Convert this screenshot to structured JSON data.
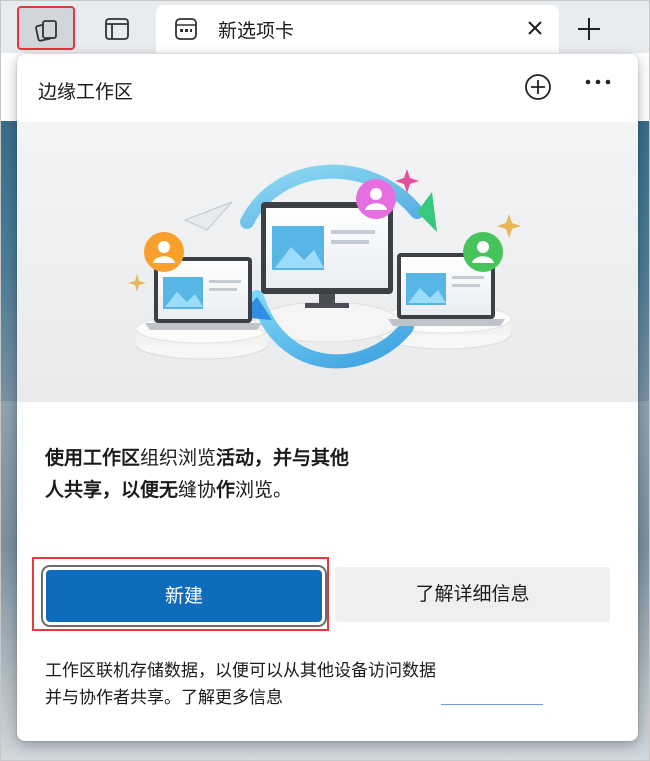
{
  "tabstrip": {
    "workspaces_icon": "workspaces-icon",
    "vertical_tabs_icon": "vertical-tabs-icon",
    "tab": {
      "title": "新选项卡",
      "favicon": "new-tab-page-icon",
      "close_icon": "close-icon"
    },
    "new_tab_icon": "plus-icon"
  },
  "flyout": {
    "title": "边缘工作区",
    "add_icon": "add-circle-icon",
    "more_icon": "more-icon",
    "description": {
      "part1": "使用工作区",
      "part2": "组织浏览",
      "part3": "活动",
      "part4": "，并与其他人共享，以便无",
      "part5": "缝协",
      "part6": "作",
      "part7": "浏览。"
    },
    "create_button": "新建",
    "learn_more_button": "了解详细信息",
    "footer_text": "工作区联机存储数据，以便可以从其他设备访问数据并与协作者共享。了解更多信息"
  },
  "colors": {
    "accent": "#0f6cbd",
    "highlight_border": "#e0393e",
    "tabstrip_bg": "#e9ecef"
  }
}
